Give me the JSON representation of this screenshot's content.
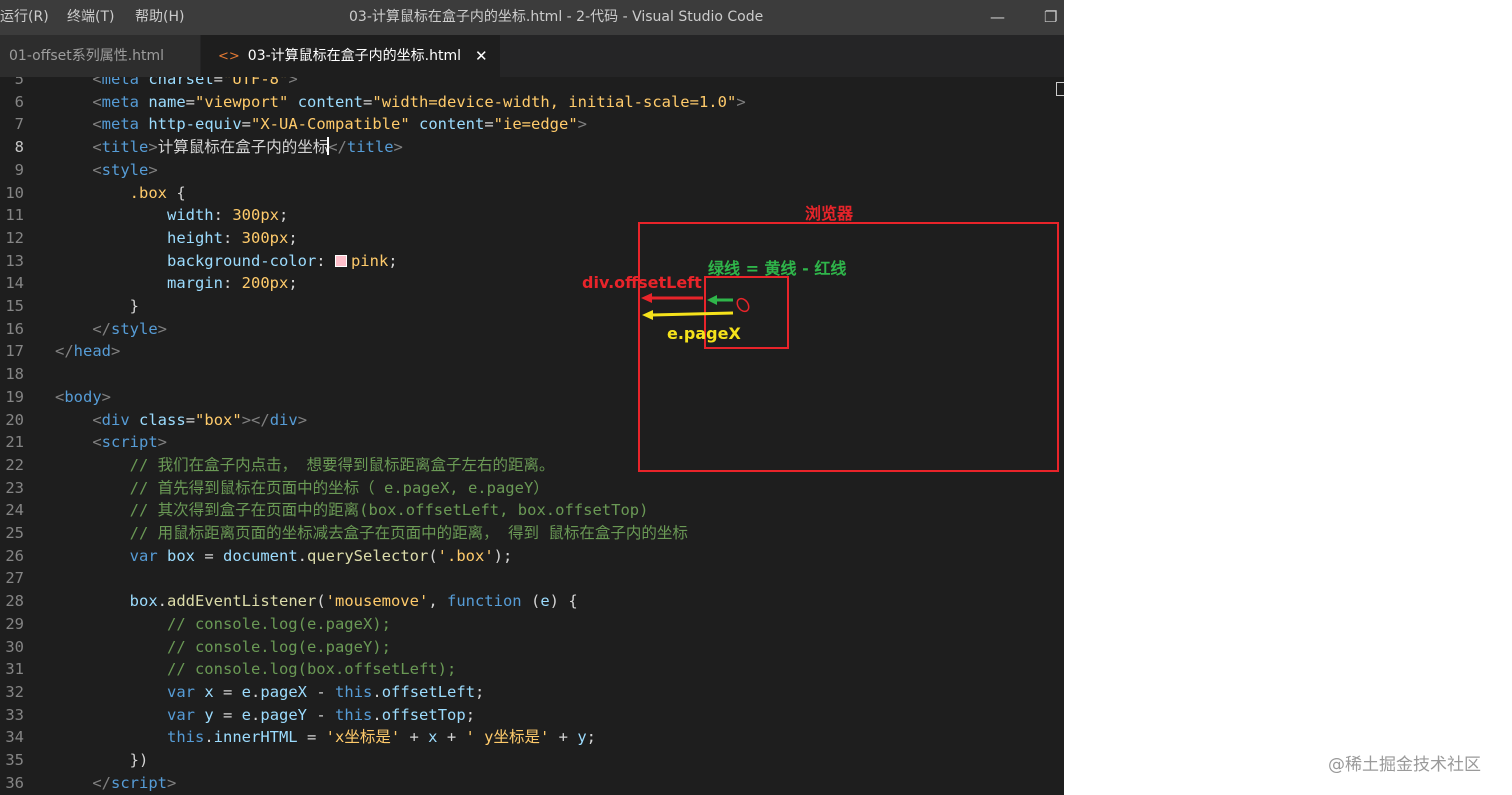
{
  "titlebar": {
    "menus": [
      "运行(R)",
      "终端(T)",
      "帮助(H)"
    ],
    "window_title": "03-计算鼠标在盒子内的坐标.html - 2-代码 - Visual Studio Code",
    "minimize_glyph": "—",
    "maximize_glyph": "❐"
  },
  "tabs": [
    {
      "label": "01-offset系列属性.html",
      "active": false
    },
    {
      "label": "03-计算鼠标在盒子内的坐标.html",
      "active": true,
      "icon": "<>",
      "close": "✕"
    }
  ],
  "editor": {
    "current_line": 8,
    "lines": [
      {
        "n": 5,
        "tokens": [
          [
            "i",
            "    "
          ],
          [
            "br",
            "<"
          ],
          [
            "tag",
            "meta"
          ],
          [
            "txt",
            " "
          ],
          [
            "attr",
            "charset"
          ],
          [
            "txt",
            "="
          ],
          [
            "str",
            "\"UTF-8\""
          ],
          [
            "br",
            ">"
          ]
        ]
      },
      {
        "n": 6,
        "tokens": [
          [
            "i",
            "    "
          ],
          [
            "br",
            "<"
          ],
          [
            "tag",
            "meta"
          ],
          [
            "txt",
            " "
          ],
          [
            "attr",
            "name"
          ],
          [
            "txt",
            "="
          ],
          [
            "str",
            "\"viewport\""
          ],
          [
            "txt",
            " "
          ],
          [
            "attr",
            "content"
          ],
          [
            "txt",
            "="
          ],
          [
            "str",
            "\"width=device-width, initial-scale=1.0\""
          ],
          [
            "br",
            ">"
          ]
        ]
      },
      {
        "n": 7,
        "tokens": [
          [
            "i",
            "    "
          ],
          [
            "br",
            "<"
          ],
          [
            "tag",
            "meta"
          ],
          [
            "txt",
            " "
          ],
          [
            "attr",
            "http-equiv"
          ],
          [
            "txt",
            "="
          ],
          [
            "str",
            "\"X-UA-Compatible\""
          ],
          [
            "txt",
            " "
          ],
          [
            "attr",
            "content"
          ],
          [
            "txt",
            "="
          ],
          [
            "str",
            "\"ie=edge\""
          ],
          [
            "br",
            ">"
          ]
        ]
      },
      {
        "n": 8,
        "tokens": [
          [
            "i",
            "    "
          ],
          [
            "br",
            "<"
          ],
          [
            "tag",
            "title"
          ],
          [
            "br",
            ">"
          ],
          [
            "txt",
            "计算鼠标在盒子内的坐标"
          ],
          [
            "cursor",
            ""
          ],
          [
            "br",
            "</"
          ],
          [
            "tag",
            "title"
          ],
          [
            "br",
            ">"
          ]
        ]
      },
      {
        "n": 9,
        "tokens": [
          [
            "i",
            "    "
          ],
          [
            "br",
            "<"
          ],
          [
            "tag",
            "style"
          ],
          [
            "br",
            ">"
          ]
        ]
      },
      {
        "n": 10,
        "tokens": [
          [
            "i",
            "        "
          ],
          [
            "sel",
            ".box"
          ],
          [
            "punc",
            " {"
          ]
        ]
      },
      {
        "n": 11,
        "tokens": [
          [
            "i",
            "            "
          ],
          [
            "prop",
            "width"
          ],
          [
            "punc",
            ": "
          ],
          [
            "num",
            "300px"
          ],
          [
            "punc",
            ";"
          ]
        ]
      },
      {
        "n": 12,
        "tokens": [
          [
            "i",
            "            "
          ],
          [
            "prop",
            "height"
          ],
          [
            "punc",
            ": "
          ],
          [
            "num",
            "300px"
          ],
          [
            "punc",
            ";"
          ]
        ]
      },
      {
        "n": 13,
        "tokens": [
          [
            "i",
            "            "
          ],
          [
            "prop",
            "background-color"
          ],
          [
            "punc",
            ": "
          ],
          [
            "swatch",
            ""
          ],
          [
            "num",
            "pink"
          ],
          [
            "punc",
            ";"
          ]
        ]
      },
      {
        "n": 14,
        "tokens": [
          [
            "i",
            "            "
          ],
          [
            "prop",
            "margin"
          ],
          [
            "punc",
            ": "
          ],
          [
            "num",
            "200px"
          ],
          [
            "punc",
            ";"
          ]
        ]
      },
      {
        "n": 15,
        "tokens": [
          [
            "i",
            "        "
          ],
          [
            "punc",
            "}"
          ]
        ]
      },
      {
        "n": 16,
        "tokens": [
          [
            "i",
            "    "
          ],
          [
            "br",
            "</"
          ],
          [
            "tag",
            "style"
          ],
          [
            "br",
            ">"
          ]
        ]
      },
      {
        "n": 17,
        "tokens": [
          [
            "br",
            "</"
          ],
          [
            "tag",
            "head"
          ],
          [
            "br",
            ">"
          ]
        ]
      },
      {
        "n": 18,
        "tokens": []
      },
      {
        "n": 19,
        "tokens": [
          [
            "br",
            "<"
          ],
          [
            "tag",
            "body"
          ],
          [
            "br",
            ">"
          ]
        ]
      },
      {
        "n": 20,
        "tokens": [
          [
            "i",
            "    "
          ],
          [
            "br",
            "<"
          ],
          [
            "tag",
            "div"
          ],
          [
            "txt",
            " "
          ],
          [
            "attr",
            "class"
          ],
          [
            "txt",
            "="
          ],
          [
            "str",
            "\"box\""
          ],
          [
            "br",
            "></"
          ],
          [
            "tag",
            "div"
          ],
          [
            "br",
            ">"
          ]
        ]
      },
      {
        "n": 21,
        "tokens": [
          [
            "i",
            "    "
          ],
          [
            "br",
            "<"
          ],
          [
            "tag",
            "script"
          ],
          [
            "br",
            ">"
          ]
        ]
      },
      {
        "n": 22,
        "tokens": [
          [
            "i",
            "        "
          ],
          [
            "com",
            "// 我们在盒子内点击， 想要得到鼠标距离盒子左右的距离。"
          ]
        ]
      },
      {
        "n": 23,
        "tokens": [
          [
            "i",
            "        "
          ],
          [
            "com",
            "// 首先得到鼠标在页面中的坐标（ e.pageX, e.pageY）"
          ]
        ]
      },
      {
        "n": 24,
        "tokens": [
          [
            "i",
            "        "
          ],
          [
            "com",
            "// 其次得到盒子在页面中的距离(box.offsetLeft, box.offsetTop)"
          ]
        ]
      },
      {
        "n": 25,
        "tokens": [
          [
            "i",
            "        "
          ],
          [
            "com",
            "// 用鼠标距离页面的坐标减去盒子在页面中的距离， 得到 鼠标在盒子内的坐标"
          ]
        ]
      },
      {
        "n": 26,
        "tokens": [
          [
            "i",
            "        "
          ],
          [
            "kw",
            "var"
          ],
          [
            "punc",
            " "
          ],
          [
            "var",
            "box"
          ],
          [
            "punc",
            " = "
          ],
          [
            "var",
            "document"
          ],
          [
            "punc",
            "."
          ],
          [
            "fn",
            "querySelector"
          ],
          [
            "punc",
            "("
          ],
          [
            "sq",
            "'.box'"
          ],
          [
            "punc",
            ");"
          ]
        ]
      },
      {
        "n": 27,
        "tokens": []
      },
      {
        "n": 28,
        "tokens": [
          [
            "i",
            "        "
          ],
          [
            "var",
            "box"
          ],
          [
            "punc",
            "."
          ],
          [
            "fn",
            "addEventListener"
          ],
          [
            "punc",
            "("
          ],
          [
            "sq",
            "'mousemove'"
          ],
          [
            "punc",
            ", "
          ],
          [
            "kw",
            "function"
          ],
          [
            "punc",
            " ("
          ],
          [
            "var",
            "e"
          ],
          [
            "punc",
            ") {"
          ]
        ]
      },
      {
        "n": 29,
        "tokens": [
          [
            "i",
            "            "
          ],
          [
            "com",
            "// console.log(e.pageX);"
          ]
        ]
      },
      {
        "n": 30,
        "tokens": [
          [
            "i",
            "            "
          ],
          [
            "com",
            "// console.log(e.pageY);"
          ]
        ]
      },
      {
        "n": 31,
        "tokens": [
          [
            "i",
            "            "
          ],
          [
            "com",
            "// console.log(box.offsetLeft);"
          ]
        ]
      },
      {
        "n": 32,
        "tokens": [
          [
            "i",
            "            "
          ],
          [
            "kw",
            "var"
          ],
          [
            "punc",
            " "
          ],
          [
            "var",
            "x"
          ],
          [
            "punc",
            " = "
          ],
          [
            "var",
            "e"
          ],
          [
            "punc",
            "."
          ],
          [
            "var",
            "pageX"
          ],
          [
            "punc",
            " - "
          ],
          [
            "kw",
            "this"
          ],
          [
            "punc",
            "."
          ],
          [
            "var",
            "offsetLeft"
          ],
          [
            "punc",
            ";"
          ]
        ]
      },
      {
        "n": 33,
        "tokens": [
          [
            "i",
            "            "
          ],
          [
            "kw",
            "var"
          ],
          [
            "punc",
            " "
          ],
          [
            "var",
            "y"
          ],
          [
            "punc",
            " = "
          ],
          [
            "var",
            "e"
          ],
          [
            "punc",
            "."
          ],
          [
            "var",
            "pageY"
          ],
          [
            "punc",
            " - "
          ],
          [
            "kw",
            "this"
          ],
          [
            "punc",
            "."
          ],
          [
            "var",
            "offsetTop"
          ],
          [
            "punc",
            ";"
          ]
        ]
      },
      {
        "n": 34,
        "tokens": [
          [
            "i",
            "            "
          ],
          [
            "kw",
            "this"
          ],
          [
            "punc",
            "."
          ],
          [
            "var",
            "innerHTML"
          ],
          [
            "punc",
            " = "
          ],
          [
            "sq",
            "'x坐标是'"
          ],
          [
            "punc",
            " + "
          ],
          [
            "var",
            "x"
          ],
          [
            "punc",
            " + "
          ],
          [
            "sq",
            "' y坐标是'"
          ],
          [
            "punc",
            " + "
          ],
          [
            "var",
            "y"
          ],
          [
            "punc",
            ";"
          ]
        ]
      },
      {
        "n": 35,
        "tokens": [
          [
            "i",
            "        "
          ],
          [
            "punc",
            "})"
          ]
        ]
      },
      {
        "n": 36,
        "tokens": [
          [
            "i",
            "    "
          ],
          [
            "br",
            "</"
          ],
          [
            "tag",
            "script"
          ],
          [
            "br",
            ">"
          ]
        ]
      }
    ]
  },
  "annotation": {
    "browser_label": "浏览器",
    "formula_label": "绿线 = 黄线 - 红线",
    "offset_label": "div.offsetLeft",
    "pagex_label": "e.pageX",
    "colors": {
      "red": "#e8242a",
      "green": "#2fb54a",
      "yellow": "#f5e21b"
    }
  },
  "watermark": "@稀土掘金技术社区"
}
